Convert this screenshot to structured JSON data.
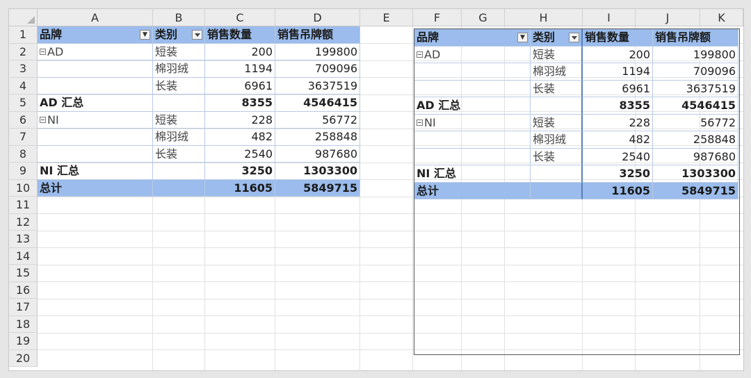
{
  "columns": [
    "A",
    "B",
    "C",
    "D",
    "E",
    "F",
    "G",
    "H",
    "I",
    "J",
    "K"
  ],
  "rows": [
    "1",
    "2",
    "3",
    "4",
    "5",
    "6",
    "7",
    "8",
    "9",
    "10",
    "11",
    "12",
    "13",
    "14",
    "15",
    "16",
    "17",
    "18",
    "19",
    "20"
  ],
  "pivot": {
    "headers": {
      "brand": "品牌",
      "category": "类别",
      "qty": "销售数量",
      "amount": "销售吊牌额"
    },
    "groups": [
      {
        "brand": "AD",
        "items": [
          {
            "category": "短装",
            "qty": "200",
            "amount": "199800"
          },
          {
            "category": "棉羽绒",
            "qty": "1194",
            "amount": "709096"
          },
          {
            "category": "长装",
            "qty": "6961",
            "amount": "3637519"
          }
        ],
        "subtotal_label": "AD 汇总",
        "subtotal_qty": "8355",
        "subtotal_amount": "4546415"
      },
      {
        "brand": "NI",
        "items": [
          {
            "category": "短装",
            "qty": "228",
            "amount": "56772"
          },
          {
            "category": "棉羽绒",
            "qty": "482",
            "amount": "258848"
          },
          {
            "category": "长装",
            "qty": "2540",
            "amount": "987680"
          }
        ],
        "subtotal_label": "NI 汇总",
        "subtotal_qty": "3250",
        "subtotal_amount": "1303300"
      }
    ],
    "total": {
      "label": "总计",
      "qty": "11605",
      "amount": "5849715"
    }
  },
  "colors": {
    "header_fill": "#9bbcec",
    "grid": "#e1e1e1",
    "background": "#e6e6e6"
  }
}
